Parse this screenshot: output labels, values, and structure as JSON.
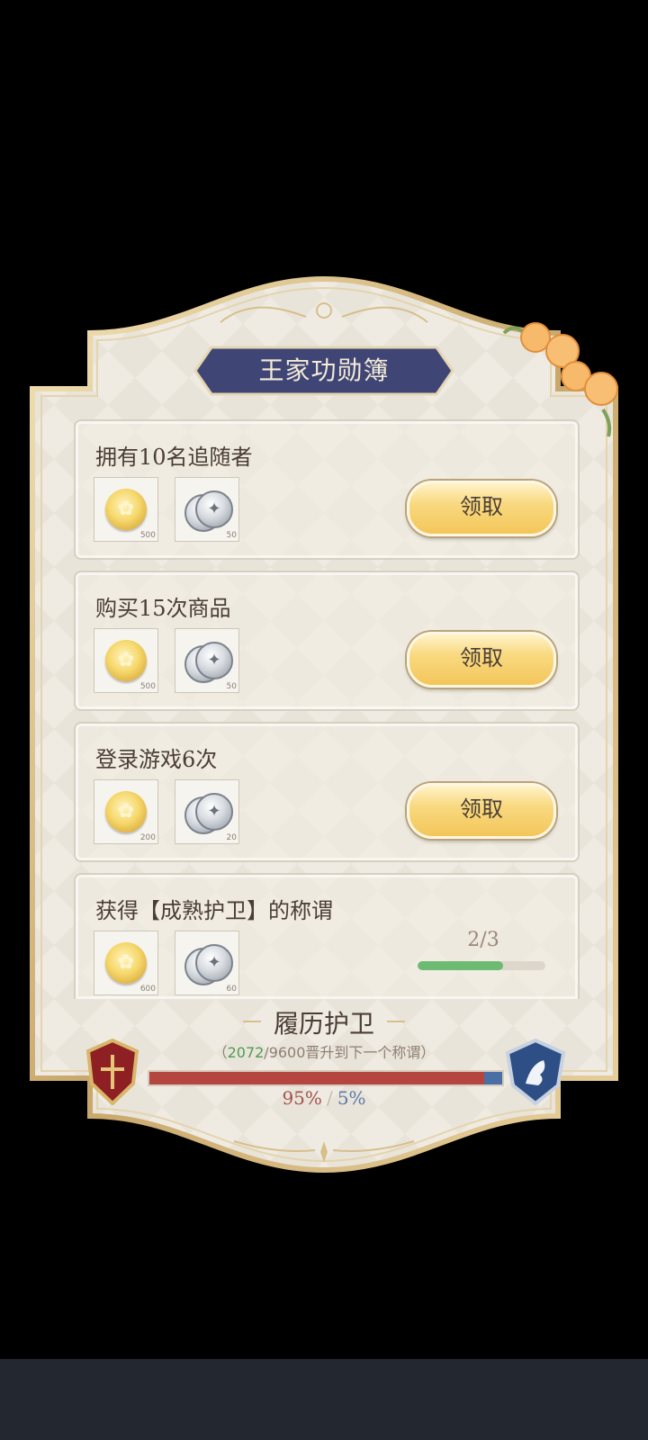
{
  "panel": {
    "title": "王家功勋簿"
  },
  "tasks": [
    {
      "title": "拥有10名追随者",
      "rewards": [
        {
          "icon": "gold-coin-icon",
          "qty": "500"
        },
        {
          "icon": "silver-coins-icon",
          "qty": "50"
        }
      ],
      "button": "领取"
    },
    {
      "title": "购买15次商品",
      "rewards": [
        {
          "icon": "gold-coin-icon",
          "qty": "500"
        },
        {
          "icon": "silver-coins-icon",
          "qty": "50"
        }
      ],
      "button": "领取"
    },
    {
      "title": "登录游戏6次",
      "rewards": [
        {
          "icon": "gold-coin-icon",
          "qty": "200"
        },
        {
          "icon": "silver-coins-icon",
          "qty": "20"
        }
      ],
      "button": "领取"
    },
    {
      "title": "获得【成熟护卫】的称谓",
      "rewards": [
        {
          "icon": "gold-coin-icon",
          "qty": "600"
        },
        {
          "icon": "silver-coins-icon",
          "qty": "60"
        }
      ],
      "progress_text": "2/3",
      "progress_fraction": 0.6667
    }
  ],
  "rank": {
    "name": "履历护卫",
    "open_paren": "（",
    "current": "2072",
    "total_text": "/9600晋升到下一个称谓",
    "close_paren": "）",
    "red_percent_text": "95%",
    "separator": "/",
    "blue_percent_text": "5%",
    "red_fraction": 0.95,
    "blue_fraction": 0.05
  },
  "colors": {
    "title_plate": "#3f4675",
    "button_gold": "#f6d06b",
    "progress_green": "#6dbb73",
    "bar_red": "#b5463f",
    "bar_blue": "#4a6fa6"
  }
}
